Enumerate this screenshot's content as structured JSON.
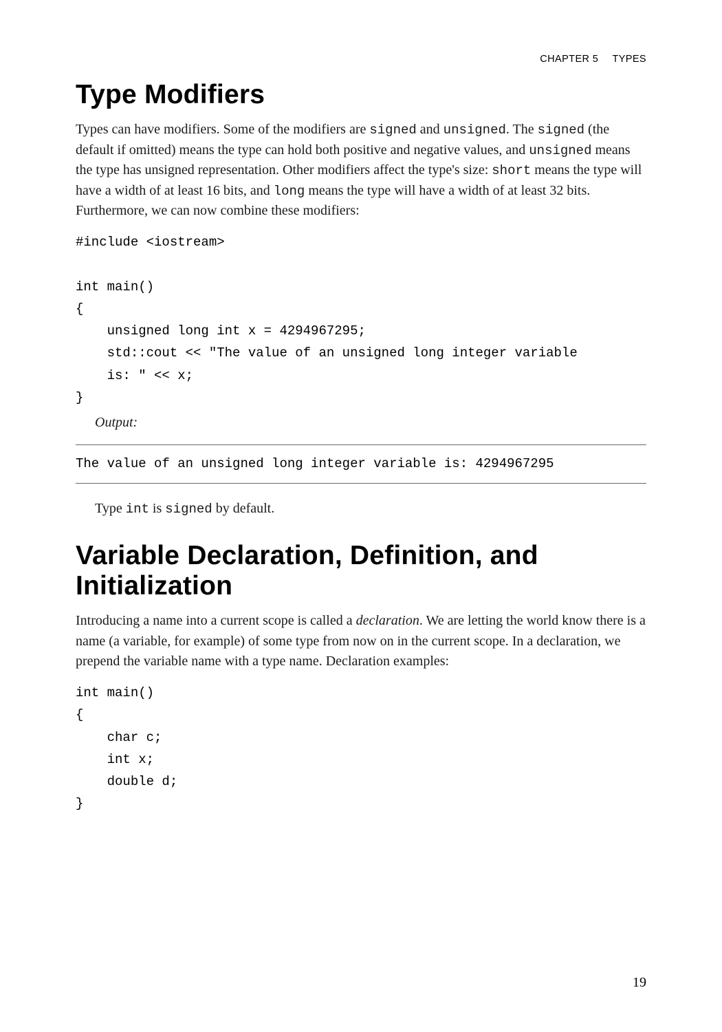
{
  "header": {
    "chapter_label": "CHAPTER 5",
    "chapter_title": "TYPES"
  },
  "sections": {
    "type_modifiers": {
      "title": "Type Modifiers",
      "intro_parts": {
        "p1": "Types can have modifiers. Some of the modifiers are ",
        "c1": "signed",
        "p2": " and ",
        "c2": "unsigned",
        "p3": ". The ",
        "c3": "signed",
        "p4": " (the default if omitted) means the type can hold both positive and negative values, and ",
        "c4": "unsigned",
        "p5": " means the type has unsigned representation. Other modifiers affect the type's size: ",
        "c5": "short",
        "p6": " means the type will have a width of at least 16 bits, and ",
        "c6": "long",
        "p7": " means the type will have a width of at least 32 bits. Furthermore, we can now combine these modifiers:"
      },
      "code": "#include <iostream>\n\nint main()\n{\n    unsigned long int x = 4294967295;\n    std::cout << \"The value of an unsigned long integer variable\n    is: \" << x;\n}",
      "output_label": "Output:",
      "output": "The value of an unsigned long integer variable is: 4294967295",
      "closing_parts": {
        "p1": "Type ",
        "c1": "int",
        "p2": " is ",
        "c2": "signed",
        "p3": " by default."
      }
    },
    "var_decl": {
      "title": "Variable Declaration, Definition, and Initialization",
      "intro_parts": {
        "p1": "Introducing a name into a current scope is called a ",
        "em1": "declaration",
        "p2": ". We are letting the world know there is a name (a variable, for example) of some type from now on in the current scope. In a declaration, we prepend the variable name with a type name. Declaration examples:"
      },
      "code": "int main()\n{\n    char c;\n    int x;\n    double d;\n}"
    }
  },
  "page_number": "19"
}
